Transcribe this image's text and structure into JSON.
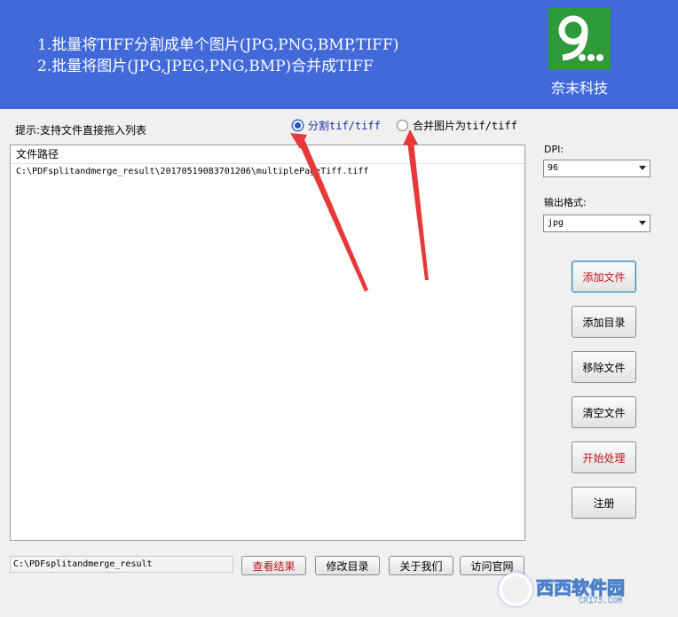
{
  "banner": {
    "line1": "1.批量将TIFF分割成单个图片(JPG,PNG,BMP,TIFF)",
    "line2": "2.批量将图片(JPG,JPEG,PNG,BMP)合并成TIFF",
    "logo_glyph": "9",
    "logo_dots": "...",
    "logo_name": "奈末科技",
    "logo_color": "#2f9a3a"
  },
  "hint": "提示:支持文件直接拖入列表",
  "mode": {
    "split_label": "分割tif/tiff",
    "merge_label": "合并图片为tif/tiff",
    "selected": "split"
  },
  "file_list": {
    "column_header": "文件路径",
    "rows": [
      "C:\\PDFsplitandmerge_result\\20170519083701206\\multiplePageTiff.tiff"
    ]
  },
  "options": {
    "dpi_label": "DPI:",
    "dpi_value": "96",
    "format_label": "输出格式:",
    "format_value": "jpg"
  },
  "side_buttons": {
    "add_file": "添加文件",
    "add_dir": "添加目录",
    "remove_file": "移除文件",
    "clear_files": "清空文件",
    "start": "开始处理",
    "register": "注册"
  },
  "bottom": {
    "output_path": "C:\\PDFsplitandmerge_result",
    "view_result": "查看结果",
    "change_dir": "修改目录",
    "about": "关于我们",
    "visit_site": "访问官网"
  },
  "watermark": {
    "name": "西西软件园",
    "domain": "CR173.COM"
  },
  "colors": {
    "banner": "#4169d9",
    "accent_red": "#c0151a",
    "annotation_arrow": "#e8393a"
  }
}
